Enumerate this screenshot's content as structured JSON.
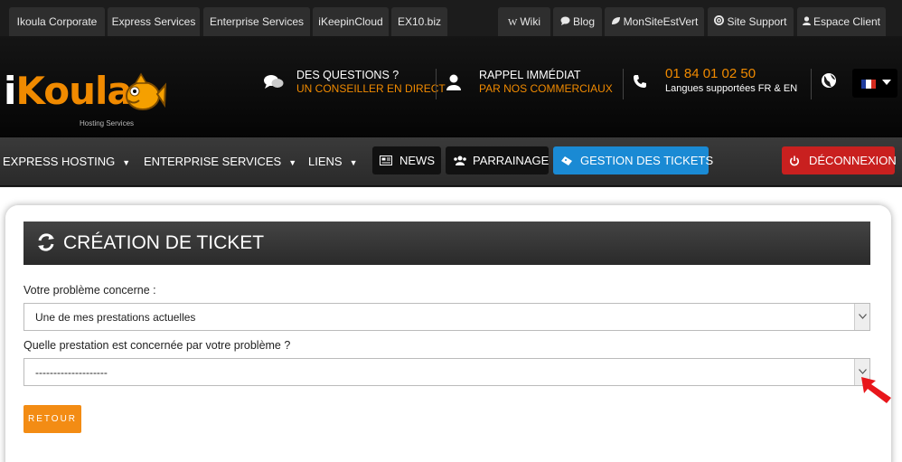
{
  "top_tabs": [
    {
      "label": "Ikoula Corporate",
      "icon": ""
    },
    {
      "label": "Express Services",
      "icon": ""
    },
    {
      "label": "Enterprise Services",
      "icon": ""
    },
    {
      "label": "iKeepinCloud",
      "icon": ""
    },
    {
      "label": "EX10.biz",
      "icon": ""
    },
    {
      "label": "Wiki",
      "icon": "W"
    },
    {
      "label": "Blog",
      "icon": "comment-icon"
    },
    {
      "label": "MonSiteEstVert",
      "icon": "leaf-icon"
    },
    {
      "label": "Site Support",
      "icon": "lifebuoy-icon"
    },
    {
      "label": "Espace Client",
      "icon": "user-icon"
    }
  ],
  "logo": {
    "text_i": "i",
    "text_rest": "Koula",
    "subtitle": "Hosting Services"
  },
  "header": {
    "questions": {
      "line1": "DES QUESTIONS ?",
      "line2": "UN CONSEILLER EN DIRECT"
    },
    "callback": {
      "line1": "RAPPEL IMMÉDIAT",
      "line2": "PAR NOS COMMERCIAUX"
    },
    "phone": {
      "number": "01 84 01 02 50",
      "languages": "Langues supportées FR & EN"
    },
    "flag_colors": [
      "#1f3c9c",
      "#ffffff",
      "#d52b1e"
    ]
  },
  "nav": {
    "express_hosting": "EXPRESS HOSTING",
    "enterprise_services": "ENTERPRISE SERVICES",
    "liens": "LIENS",
    "news": "NEWS",
    "parrainage": "PARRAINAGE",
    "gestion_tickets": "GESTION DES TICKETS",
    "deconnexion": "DÉCONNEXION"
  },
  "colors": {
    "accent_orange": "#f08a00",
    "active_blue": "#1a8ad4",
    "logout_red": "#c9201f"
  },
  "page": {
    "title": "CRÉATION DE TICKET",
    "problem_label": "Votre problème concerne :",
    "problem_value": "Une de mes prestations actuelles",
    "service_label": "Quelle prestation est concernée par votre problème ?",
    "service_value": "--------------------",
    "back_button": "RETOUR"
  }
}
